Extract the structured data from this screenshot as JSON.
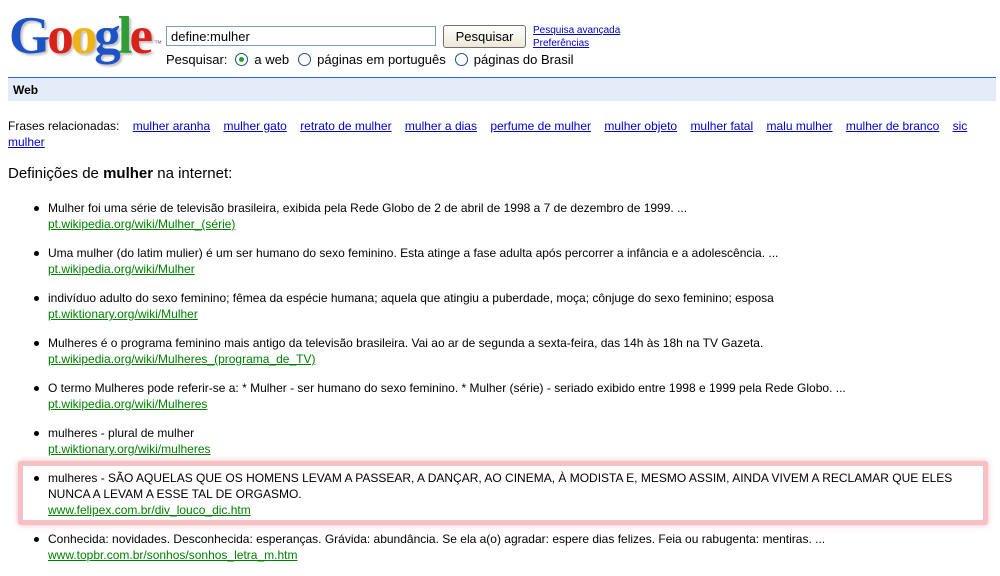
{
  "logo_text": "Google",
  "logo_tm": "™",
  "logo_letters": [
    {
      "ch": "G",
      "color": "#1d53c4"
    },
    {
      "ch": "o",
      "color": "#d92218"
    },
    {
      "ch": "o",
      "color": "#f1b216"
    },
    {
      "ch": "g",
      "color": "#1d53c4"
    },
    {
      "ch": "l",
      "color": "#2f9c36"
    },
    {
      "ch": "e",
      "color": "#d92218"
    }
  ],
  "search": {
    "value": "define:mulher",
    "button": "Pesquisar"
  },
  "header_links": {
    "advanced": "Pesquisa avançada",
    "preferences": "Preferências"
  },
  "scope": {
    "label": "Pesquisar:",
    "options": [
      "a web",
      "páginas em português",
      "páginas do Brasil"
    ],
    "selected": 0
  },
  "webbar": {
    "label": "Web"
  },
  "related": {
    "label": "Frases relacionadas:",
    "links": [
      "mulher aranha",
      "mulher gato",
      "retrato de mulher",
      "mulher a dias",
      "perfume de mulher",
      "mulher objeto",
      "mulher fatal",
      "malu mulher",
      "mulher de branco",
      "sic mulher"
    ]
  },
  "definitions_heading": {
    "prefix": "Definições de ",
    "term": "mulher",
    "suffix": " na internet:"
  },
  "definitions": [
    {
      "text": "Mulher foi uma série de televisão brasileira, exibida pela Rede Globo de 2 de abril de 1998 a 7 de dezembro de 1999. ...",
      "url": "pt.wikipedia.org/wiki/Mulher_(série)"
    },
    {
      "text": "Uma mulher (do latim mulier) é um ser humano do sexo feminino. Esta atinge a fase adulta após percorrer a infância e a adolescência. ...",
      "url": "pt.wikipedia.org/wiki/Mulher"
    },
    {
      "text": "indivíduo adulto do sexo feminino; fêmea da espécie humana; aquela que atingiu a puberdade, moça; cônjuge do sexo feminino; esposa",
      "url": "pt.wiktionary.org/wiki/Mulher"
    },
    {
      "text": "Mulheres é o programa feminino mais antigo da televisão brasileira. Vai ao ar de segunda a sexta-feira, das 14h às 18h na TV Gazeta.",
      "url": "pt.wikipedia.org/wiki/Mulheres_(programa_de_TV)"
    },
    {
      "text": "O termo Mulheres pode referir-se a: * Mulher - ser humano do sexo feminino. * Mulher (série) - seriado exibido entre 1998 e 1999 pela Rede Globo. ...",
      "url": "pt.wikipedia.org/wiki/Mulheres"
    },
    {
      "text": "mulheres - plural de mulher",
      "url": "pt.wiktionary.org/wiki/mulheres"
    },
    {
      "text": "mulheres - SÃO AQUELAS QUE OS HOMENS LEVAM A PASSEAR, A DANÇAR, AO CINEMA, À MODISTA E, MESMO ASSIM, AINDA VIVEM A RECLAMAR QUE ELES NUNCA A LEVAM A ESSE TAL DE ORGASMO.",
      "url": "www.felipex.com.br/div_louco_dic.htm"
    },
    {
      "text": "Conhecida: novidades. Desconhecida: esperanças. Grávida: abundância. Se ela a(o) agradar: espere dias felizes. Feia ou rabugenta: mentiras. ...",
      "url": "www.topbr.com.br/sonhos/sonhos_letra_m.htm"
    }
  ]
}
